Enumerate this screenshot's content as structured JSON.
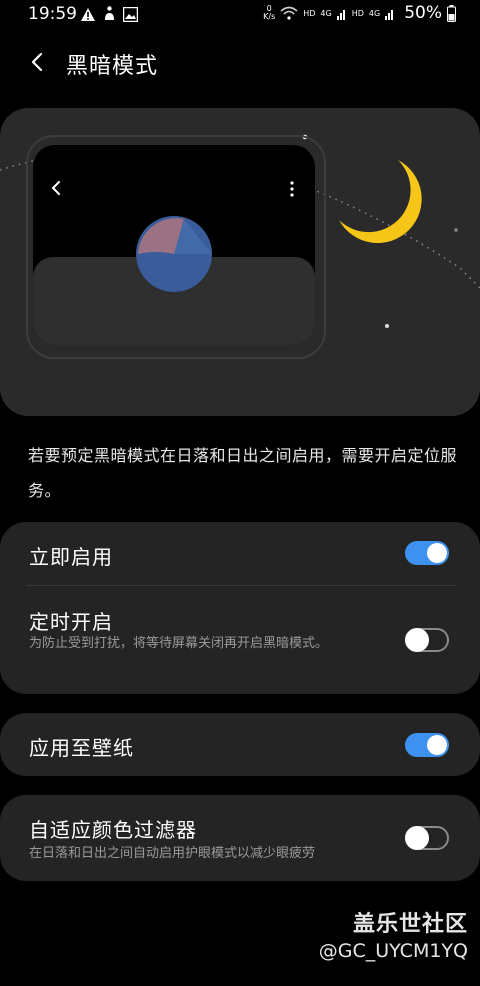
{
  "status_bar": {
    "time": "19:59",
    "net_speed_top": "0",
    "net_speed_unit": "K/s",
    "sim1": "HD",
    "sim1_net": "4G",
    "sim2": "HD",
    "sim2_net": "4G",
    "battery": "50%"
  },
  "header": {
    "title": "黑暗模式"
  },
  "description": "若要预定黑暗模式在日落和日出之间启用，需要开启定位服务。",
  "settings": {
    "enable_now": {
      "title": "立即启用",
      "state": "on"
    },
    "scheduled": {
      "title": "定时开启",
      "subtitle": "为防止受到打扰，将等待屏幕关闭再开启黑暗模式。",
      "state": "off"
    },
    "apply_wallpaper": {
      "title": "应用至壁纸",
      "state": "on"
    },
    "adaptive_filter": {
      "title": "自适应颜色过滤器",
      "subtitle": "在日落和日出之间自动启用护眼模式以减少眼疲劳",
      "state": "off"
    }
  },
  "watermark": {
    "brand": "盖乐世社区",
    "user": "@GC_UYCM1YQ"
  },
  "colors": {
    "accent": "#3e91f0",
    "moon": "#f5c518",
    "card": "#242424",
    "hero": "#2a2a2a"
  }
}
